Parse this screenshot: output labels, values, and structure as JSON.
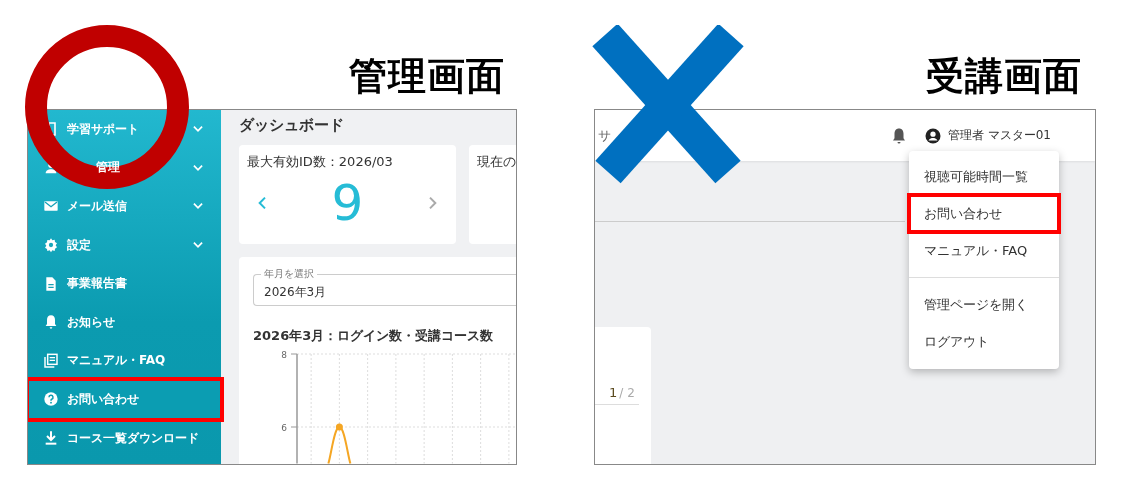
{
  "admin_panel": {
    "heading": "管理画面",
    "sidebar": {
      "items": [
        {
          "label": "学習サポート",
          "expandable": true,
          "highlighted": false
        },
        {
          "label": "管理",
          "expandable": true,
          "highlighted": false
        },
        {
          "label": "メール送信",
          "expandable": true,
          "highlighted": false
        },
        {
          "label": "設定",
          "expandable": true,
          "highlighted": false
        },
        {
          "label": "事業報告書",
          "expandable": false,
          "highlighted": false
        },
        {
          "label": "お知らせ",
          "expandable": false,
          "highlighted": false
        },
        {
          "label": "マニュアル・FAQ",
          "expandable": false,
          "highlighted": false
        },
        {
          "label": "お問い合わせ",
          "expandable": false,
          "highlighted": true
        },
        {
          "label": "コース一覧ダウンロード",
          "expandable": false,
          "highlighted": false
        }
      ]
    },
    "page_title": "ダッシュボード",
    "cards": [
      {
        "title": "最大有効ID数：2026/03",
        "value": "9"
      },
      {
        "title": "現在の"
      }
    ],
    "month_select": {
      "label": "年月を選択",
      "value": "2026年3月"
    },
    "chart": {
      "title": "2026年3月：ログイン数・受講コース数",
      "chart_data": {
        "type": "line",
        "yticks": [
          6,
          8
        ],
        "ylim": [
          5,
          8
        ],
        "grid": true,
        "series": [
          {
            "color": "#f5a623",
            "marker": "circle",
            "values": [
              null,
              6,
              null,
              null,
              null,
              null,
              null,
              null
            ]
          }
        ]
      }
    }
  },
  "learner_panel": {
    "heading": "受講画面",
    "header": {
      "nav_text": "サ",
      "user": "管理者 マスター01"
    },
    "pager": {
      "current": "1",
      "total": "/ 2"
    },
    "user_menu": [
      {
        "label": "視聴可能時間一覧",
        "highlighted": false
      },
      {
        "label": "お問い合わせ",
        "highlighted": true
      },
      {
        "label": "マニュアル・FAQ",
        "highlighted": false
      },
      {
        "kind": "divider"
      },
      {
        "label": "管理ページを開く",
        "highlighted": false
      },
      {
        "label": "ログアウト",
        "highlighted": false
      }
    ]
  }
}
